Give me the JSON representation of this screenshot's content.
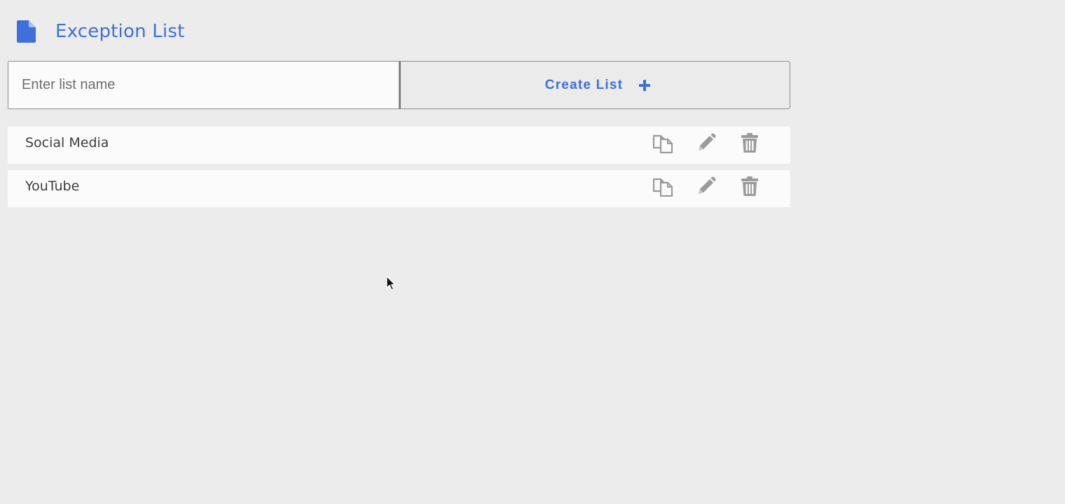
{
  "header": {
    "title": "Exception List",
    "icon": "document-icon",
    "accent": "#3f6fd9"
  },
  "create_form": {
    "input_value": "",
    "input_placeholder": "Enter list name",
    "button_label": "Create List",
    "button_icon": "plus-icon"
  },
  "lists": [
    {
      "name": "Social Media",
      "actions": [
        "copy-icon",
        "pencil-icon",
        "trash-icon"
      ]
    },
    {
      "name": "YouTube",
      "actions": [
        "copy-icon",
        "pencil-icon",
        "trash-icon"
      ]
    }
  ],
  "colors": {
    "background": "#ececec",
    "row_background": "#fbfbfb",
    "icon_gray": "#9a9a9a"
  }
}
